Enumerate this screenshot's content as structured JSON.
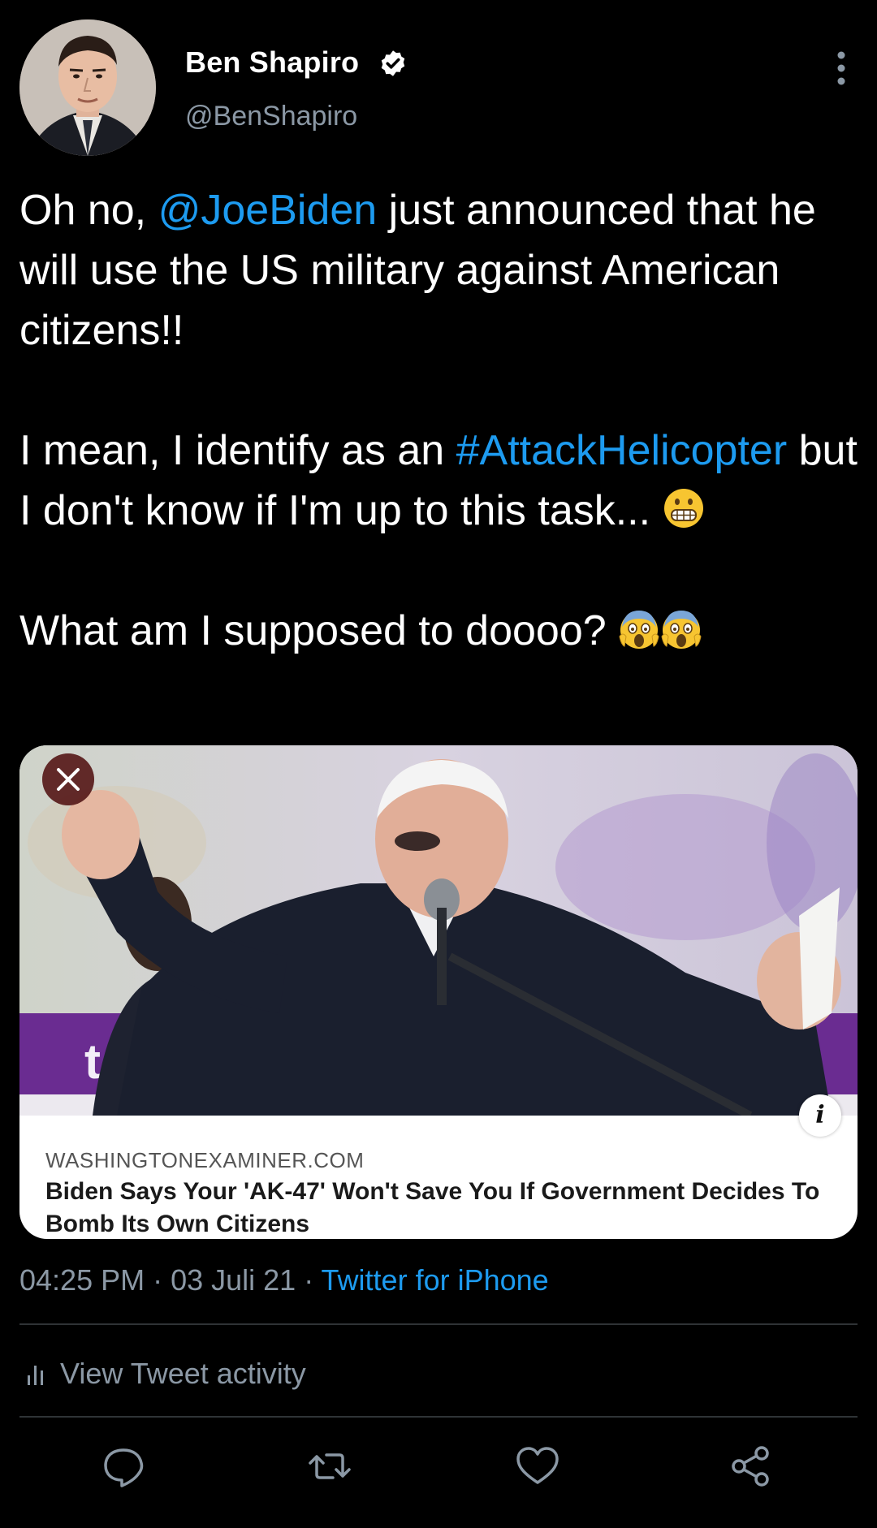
{
  "user": {
    "display_name": "Ben Shapiro",
    "handle": "@BenShapiro",
    "verified": true
  },
  "tweet": {
    "p1": {
      "before": "Oh no, ",
      "mention": "@JoeBiden",
      "after": " just announced that he will use the US military against American citizens!!"
    },
    "p2": {
      "before": "I mean, I identify as an ",
      "hashtag": "#AttackHelicopter",
      "after": " but I don't know if I'm up to this task... ",
      "emoji": "grimacing-face"
    },
    "p3": {
      "text": "What am I supposed to doooo? ",
      "emoji": "screaming-face"
    }
  },
  "card": {
    "domain": "WASHINGTONEXAMINER.COM",
    "title": "Biden Says Your 'AK-47' Won't Save You If Government Decides To Bomb Its Own Citizens",
    "image_overlay_text": "text"
  },
  "meta": {
    "time": "04:25 PM",
    "separator": " · ",
    "date": "03 Juli 21",
    "source": "Twitter for iPhone"
  },
  "activity": {
    "label": "View Tweet activity"
  },
  "actions": [
    "reply-icon",
    "retweet-icon",
    "like-icon",
    "share-icon"
  ],
  "colors": {
    "background": "#000000",
    "link": "#1d9bf0",
    "secondary_text": "#8b98a5",
    "divider": "#2f3336"
  }
}
